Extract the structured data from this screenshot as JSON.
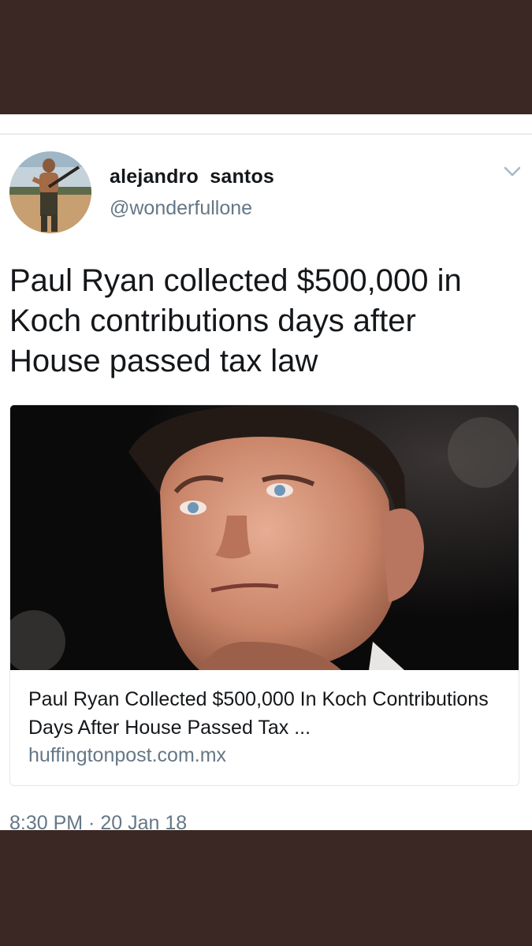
{
  "tweet": {
    "display_name": "alejandro  santos",
    "handle": "@wonderfullone",
    "text": "Paul Ryan collected $500,000 in Koch contributions days after House passed tax law",
    "timestamp": "8:30 PM · 20 Jan 18",
    "avatar_icon": "profile-photo",
    "menu_icon": "chevron-down-icon"
  },
  "card": {
    "title": "Paul Ryan Collected $500,000 In Koch Contributions Days After House Passed Tax ...",
    "domain": "huffingtonpost.com.mx",
    "image_icon": "photo-paul-ryan"
  },
  "colors": {
    "frame": "#3b2723",
    "text_primary": "#14171a",
    "text_secondary": "#657786",
    "border": "#e1e8ed"
  }
}
